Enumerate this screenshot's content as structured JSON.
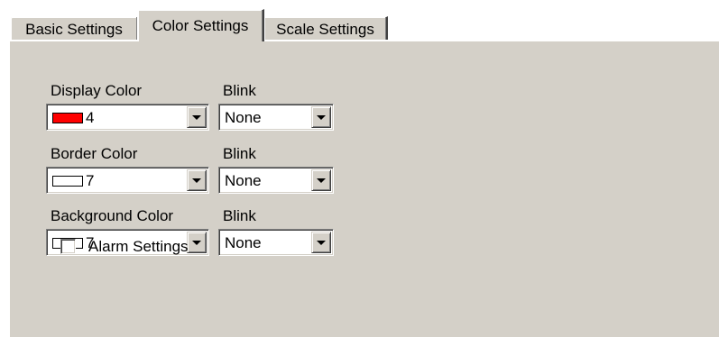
{
  "tabs": [
    {
      "label": "Basic Settings",
      "active": false
    },
    {
      "label": "Color Settings",
      "active": true
    },
    {
      "label": "Scale Settings",
      "active": false
    }
  ],
  "rows": [
    {
      "label": "Display Color",
      "color_value": "4",
      "swatch_color": "#ff0000",
      "blink_label": "Blink",
      "blink_value": "None"
    },
    {
      "label": "Border Color",
      "color_value": "7",
      "swatch_color": "#ffffff",
      "blink_label": "Blink",
      "blink_value": "None"
    },
    {
      "label": "Background Color",
      "color_value": "7",
      "swatch_color": "#ffffff",
      "blink_label": "Blink",
      "blink_value": "None"
    }
  ],
  "alarm": {
    "label": "Alarm Settings",
    "checked": false
  }
}
